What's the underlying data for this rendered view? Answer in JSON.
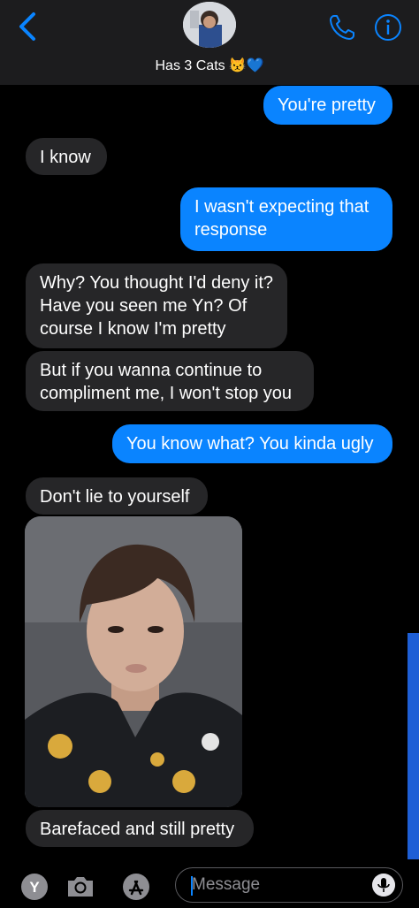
{
  "header": {
    "contact_name": "Has 3 Cats",
    "contact_emojis": "😾💙"
  },
  "messages": [
    {
      "from": "me",
      "text": "You're pretty"
    },
    {
      "from": "them",
      "text": "I know"
    },
    {
      "from": "me",
      "text": "I wasn't expecting that response"
    },
    {
      "from": "them",
      "text": "Why? You thought I'd deny it? Have you seen me Yn? Of course I know I'm pretty"
    },
    {
      "from": "them",
      "text": "But if you wanna continue to compliment me, I won't stop you"
    },
    {
      "from": "me",
      "text": "You know what? You kinda ugly"
    },
    {
      "from": "them",
      "text": "Don't lie to yourself"
    },
    {
      "from": "them",
      "text": "Barefaced and still pretty"
    }
  ],
  "composer": {
    "placeholder": "Message",
    "apps": [
      "Y",
      "camera-icon",
      "app-store-icon"
    ]
  },
  "colors": {
    "sent_bubble": "#0a84ff",
    "received_bubble": "#262628",
    "header_bg": "#1c1c1e",
    "background": "#000000"
  }
}
